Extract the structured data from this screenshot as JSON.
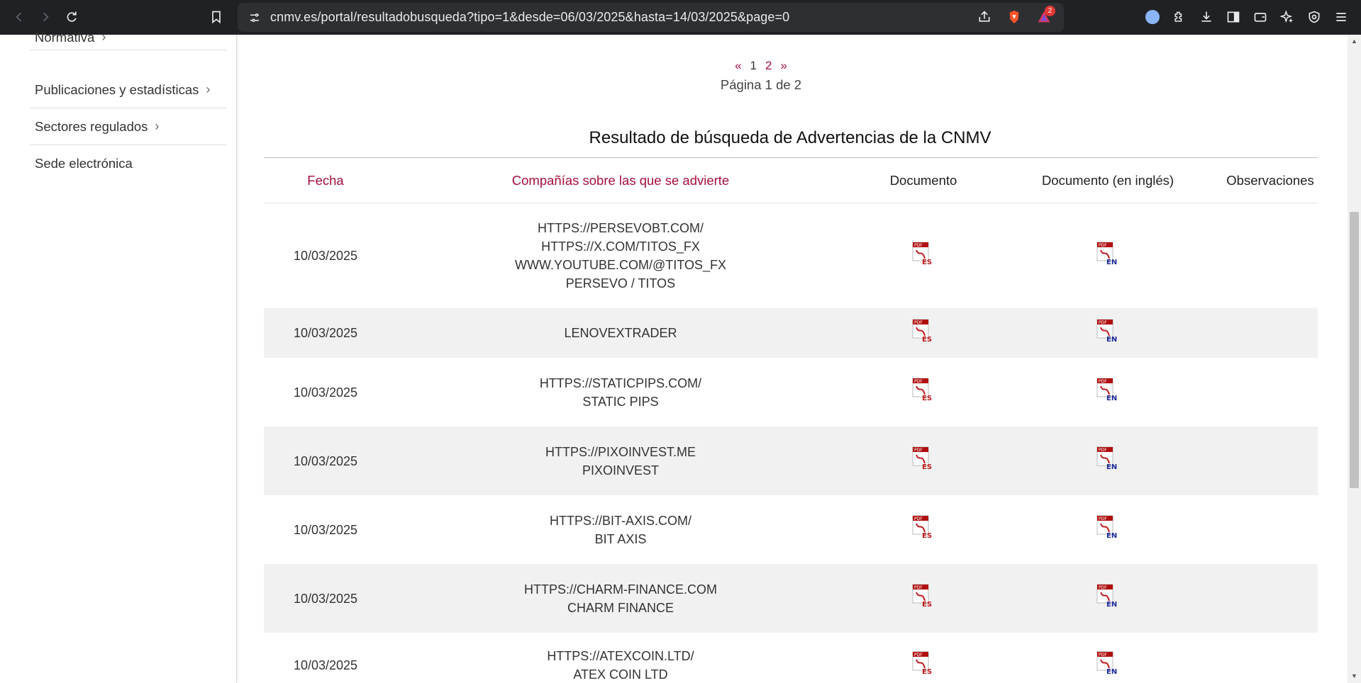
{
  "browser": {
    "url": "cnmv.es/portal/resultadobusqueda?tipo=1&desde=06/03/2025&hasta=14/03/2025&page=0",
    "alert_badge_count": "2"
  },
  "sidebar": {
    "items": [
      {
        "label": "Normativa"
      },
      {
        "label": "Publicaciones y estadísticas"
      },
      {
        "label": "Sectores regulados"
      },
      {
        "label": "Sede electrónica"
      }
    ]
  },
  "pagination": {
    "prev": "«",
    "current": "1",
    "next_page": "2",
    "next": "»",
    "info": "Página 1 de 2"
  },
  "results": {
    "title": "Resultado de búsqueda de Advertencias de la CNMV",
    "columns": [
      "Fecha",
      "Compañías sobre las que se advierte",
      "Documento",
      "Documento (en inglés)",
      "Observaciones"
    ],
    "rows": [
      {
        "date": "10/03/2025",
        "companies": [
          "HTTPS://PERSEVOBT.COM/",
          "HTTPS://X.COM/TITOS_FX",
          "WWW.YOUTUBE.COM/@TITOS_FX",
          "PERSEVO / TITOS"
        ]
      },
      {
        "date": "10/03/2025",
        "companies": [
          "LENOVEXTRADER"
        ]
      },
      {
        "date": "10/03/2025",
        "companies": [
          "HTTPS://STATICPIPS.COM/",
          "STATIC PIPS"
        ]
      },
      {
        "date": "10/03/2025",
        "companies": [
          "HTTPS://PIXOINVEST.ME",
          "PIXOINVEST"
        ]
      },
      {
        "date": "10/03/2025",
        "companies": [
          "HTTPS://BIT-AXIS.COM/",
          "BIT AXIS"
        ]
      },
      {
        "date": "10/03/2025",
        "companies": [
          "HTTPS://CHARM-FINANCE.COM",
          "CHARM FINANCE"
        ]
      },
      {
        "date": "10/03/2025",
        "companies": [
          "HTTPS://ATEXCOIN.LTD/",
          "ATEX COIN LTD"
        ]
      }
    ],
    "pdf_es_label": "ES",
    "pdf_en_label": "EN"
  },
  "colors": {
    "accent": "#a50f3c",
    "row_alt": "#f1f1f1",
    "chrome_bg": "#202124"
  }
}
